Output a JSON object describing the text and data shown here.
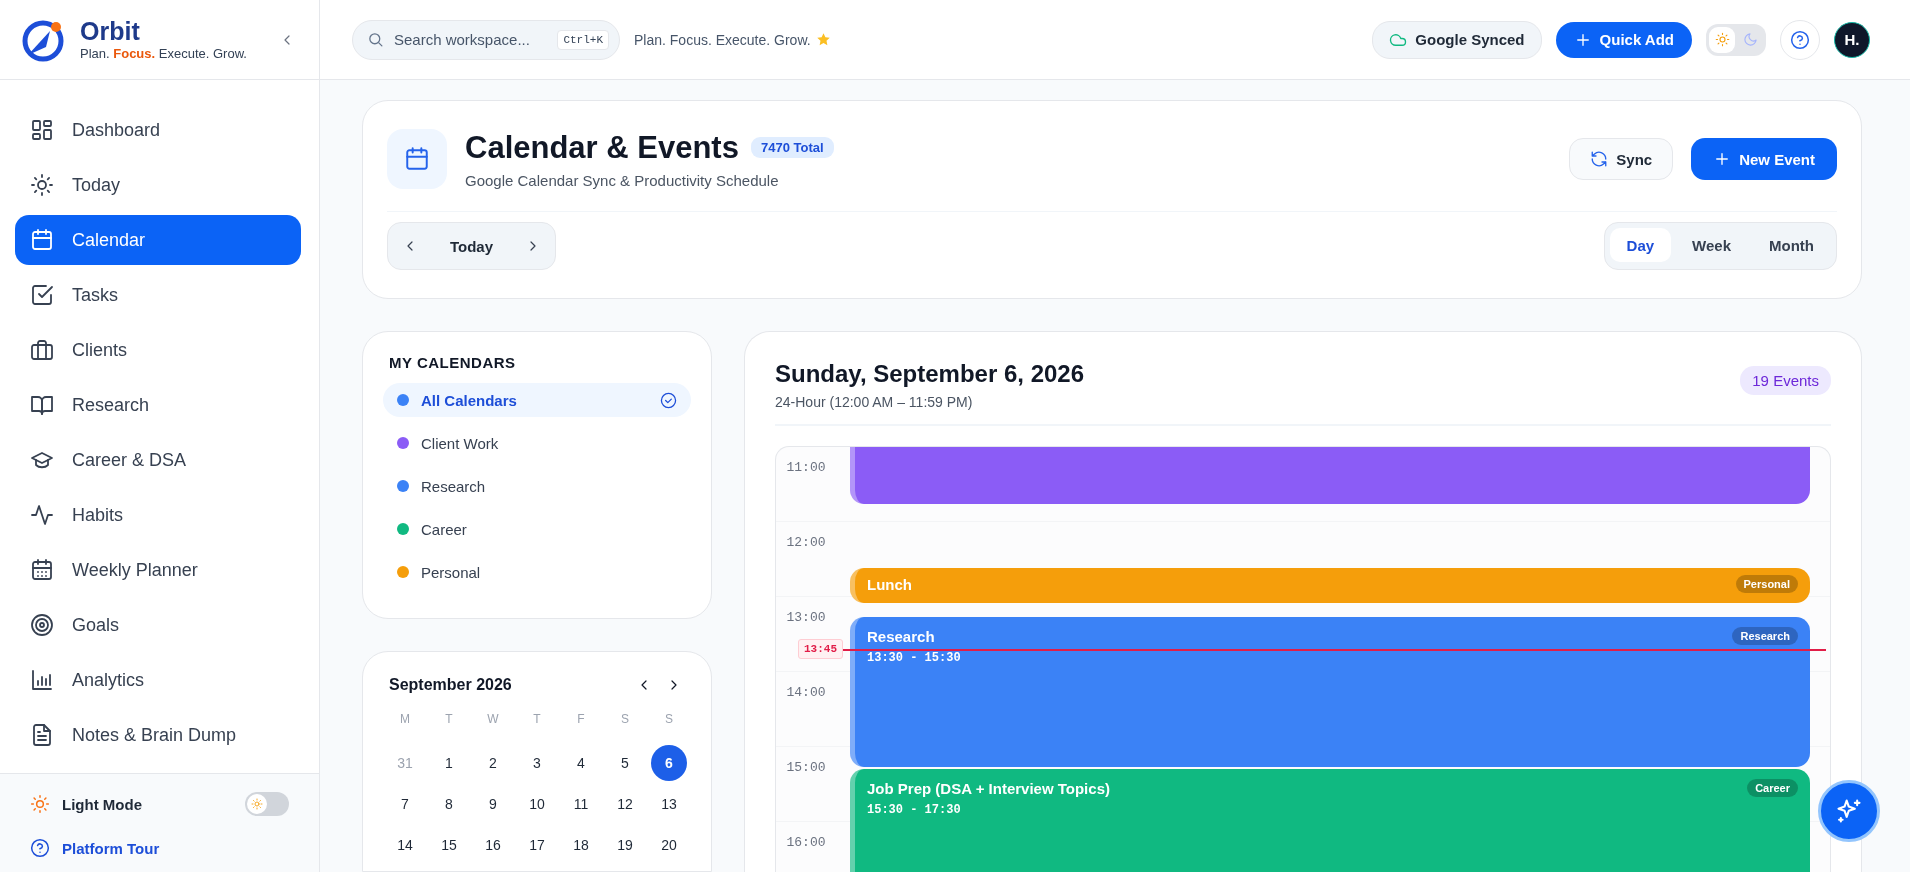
{
  "brand": {
    "name": "Orbit",
    "tagline": "Plan. **Focus.** Execute. Grow."
  },
  "topbar": {
    "search": {
      "placeholder": "Search workspace...",
      "shortcut": "Ctrl+K"
    },
    "motto": "Plan. Focus. Execute. Grow.",
    "sync_status": "Google Synced",
    "quick_add": "Quick Add",
    "theme": {
      "light_selected": true
    },
    "avatar": "H."
  },
  "sidebar": {
    "items": [
      {
        "label": "Dashboard",
        "selected": false
      },
      {
        "label": "Today",
        "selected": false
      },
      {
        "label": "Calendar",
        "selected": true
      },
      {
        "label": "Tasks",
        "selected": false
      },
      {
        "label": "Clients",
        "selected": false
      },
      {
        "label": "Research",
        "selected": false
      },
      {
        "label": "Career & DSA",
        "selected": false
      },
      {
        "label": "Habits",
        "selected": false
      },
      {
        "label": "Weekly Planner",
        "selected": false
      },
      {
        "label": "Goals",
        "selected": false
      },
      {
        "label": "Analytics",
        "selected": false
      },
      {
        "label": "Notes & Brain Dump",
        "selected": false
      }
    ],
    "light_mode": {
      "label": "Light Mode",
      "on": false
    },
    "tour": "Platform Tour"
  },
  "header": {
    "title": "Calendar & Events",
    "total": "7470 Total",
    "subtitle": "Google Calendar Sync & Productivity Schedule",
    "sync": "Sync",
    "new_event": "New Event",
    "nav_label": "Today",
    "views": [
      {
        "label": "Day",
        "selected": true
      },
      {
        "label": "Week",
        "selected": false
      },
      {
        "label": "Month",
        "selected": false
      }
    ]
  },
  "calendars": {
    "heading": "MY CALENDARS",
    "items": [
      {
        "label": "All Calendars",
        "color": "#3b82f6",
        "selected": true
      },
      {
        "label": "Client Work",
        "color": "#8b5cf6",
        "selected": false
      },
      {
        "label": "Research",
        "color": "#3b82f6",
        "selected": false
      },
      {
        "label": "Career",
        "color": "#10b981",
        "selected": false
      },
      {
        "label": "Personal",
        "color": "#f59e0b",
        "selected": false
      }
    ]
  },
  "mini_calendar": {
    "month": "September 2026",
    "weekdays": [
      "M",
      "T",
      "W",
      "T",
      "F",
      "S",
      "S"
    ],
    "days": [
      {
        "label": "31",
        "muted": true,
        "selected": false
      },
      {
        "label": "1",
        "muted": false,
        "selected": false
      },
      {
        "label": "2",
        "muted": false,
        "selected": false
      },
      {
        "label": "3",
        "muted": false,
        "selected": false
      },
      {
        "label": "4",
        "muted": false,
        "selected": false
      },
      {
        "label": "5",
        "muted": false,
        "selected": false
      },
      {
        "label": "6",
        "muted": false,
        "selected": true
      },
      {
        "label": "7",
        "muted": false,
        "selected": false
      },
      {
        "label": "8",
        "muted": false,
        "selected": false
      },
      {
        "label": "9",
        "muted": false,
        "selected": false
      },
      {
        "label": "10",
        "muted": false,
        "selected": false
      },
      {
        "label": "11",
        "muted": false,
        "selected": false
      },
      {
        "label": "12",
        "muted": false,
        "selected": false
      },
      {
        "label": "13",
        "muted": false,
        "selected": false
      },
      {
        "label": "14",
        "muted": false,
        "selected": false
      },
      {
        "label": "15",
        "muted": false,
        "selected": false
      },
      {
        "label": "16",
        "muted": false,
        "selected": false
      },
      {
        "label": "17",
        "muted": false,
        "selected": false
      },
      {
        "label": "18",
        "muted": false,
        "selected": false
      },
      {
        "label": "19",
        "muted": false,
        "selected": false
      },
      {
        "label": "20",
        "muted": false,
        "selected": false
      }
    ]
  },
  "day_view": {
    "title": "Sunday, September 6, 2026",
    "subtitle": "24-Hour (12:00 AM – 11:59 PM)",
    "count": "19 Events",
    "hours": [
      "11:00",
      "12:00",
      "13:00",
      "14:00",
      "15:00",
      "16:00"
    ],
    "now": "13:45",
    "events": [
      {
        "color": "#8b5cf6"
      },
      {
        "title": "Lunch",
        "tag": "Personal",
        "color": "#f59e0b"
      },
      {
        "title": "Research",
        "time": "13:30 - 15:30",
        "tag": "Research",
        "color": "#3b82f6"
      },
      {
        "title": "Job Prep (DSA + Interview Topics)",
        "time": "15:30 - 17:30",
        "tag": "Career",
        "color": "#10b981"
      }
    ]
  }
}
